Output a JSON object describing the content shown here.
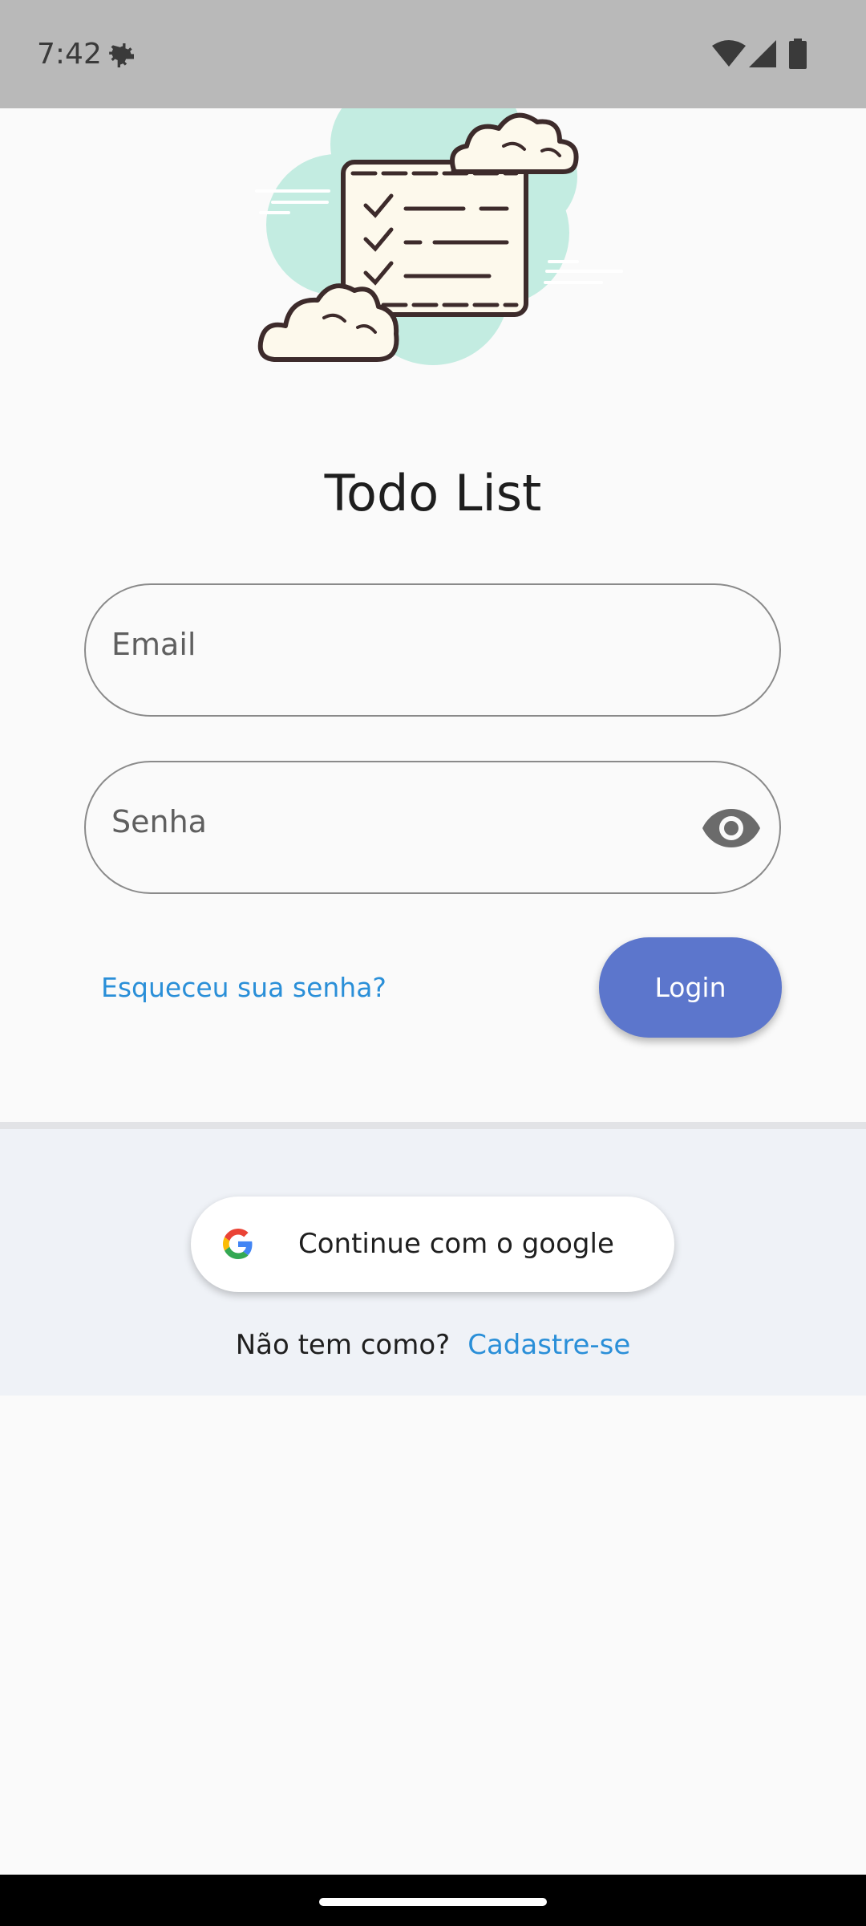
{
  "status_bar": {
    "time": "7:42",
    "icons": [
      "settings-gear-icon",
      "wifi-icon",
      "signal-icon",
      "battery-icon"
    ]
  },
  "illustration": {
    "name": "checklist-clouds-illustration",
    "colors": {
      "cloud_teal": "#c3ece1",
      "paper": "#fdf9ec",
      "outline": "#3d2b2b"
    }
  },
  "app": {
    "title": "Todo List"
  },
  "form": {
    "email_placeholder": "Email",
    "password_placeholder": "Senha",
    "password_toggle_icon": "eye-icon",
    "forgot_password": "Esqueceu sua senha?",
    "login_label": "Login"
  },
  "social": {
    "google_label": "Continue com o google",
    "google_icon": "google-g-icon"
  },
  "signup": {
    "prompt": "Não tem como?",
    "link": "Cadastre-se"
  },
  "colors": {
    "primary": "#5c76cc",
    "link": "#2a8fd8",
    "background": "#fafafa",
    "panel": "#eff2f7"
  }
}
